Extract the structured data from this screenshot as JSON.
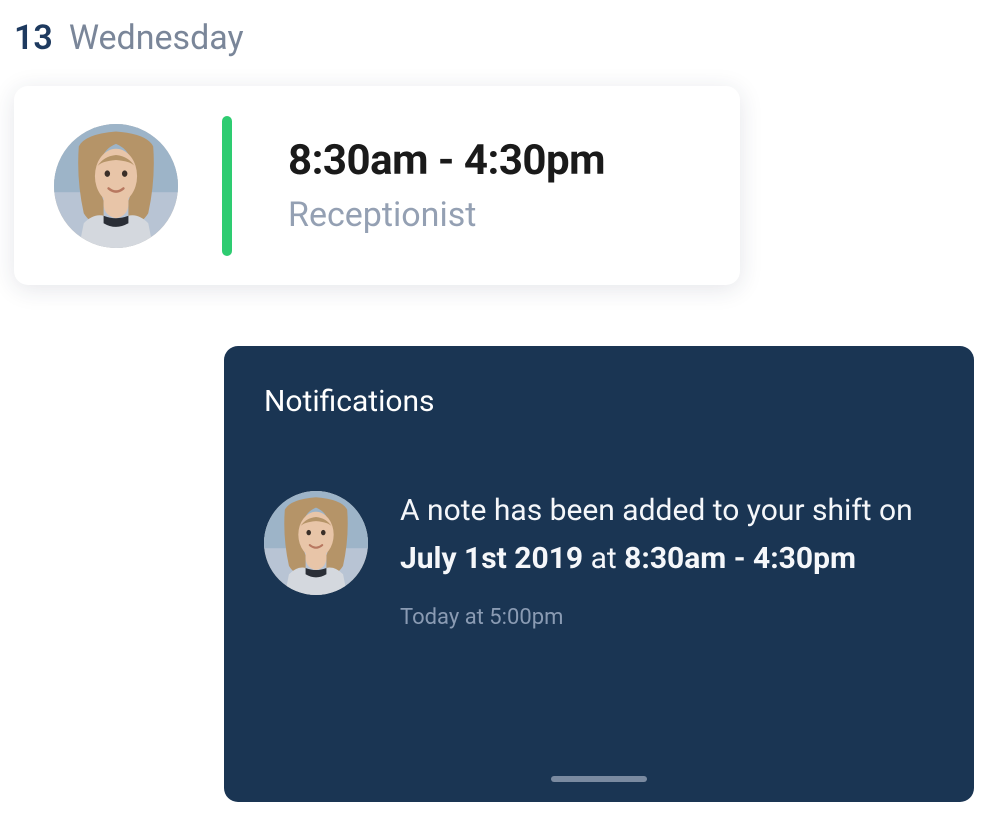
{
  "date": {
    "number": "13",
    "day": "Wednesday"
  },
  "shift": {
    "time": "8:30am - 4:30pm",
    "role": "Receptionist",
    "accent_color": "#2ecc71"
  },
  "notifications": {
    "title": "Notifications",
    "items": [
      {
        "message_prefix": "A note has been added to your shift on ",
        "message_date": "July 1st 2019",
        "message_mid": " at ",
        "message_time": "8:30am - 4:30pm",
        "timestamp": "Today at 5:00pm"
      }
    ]
  }
}
